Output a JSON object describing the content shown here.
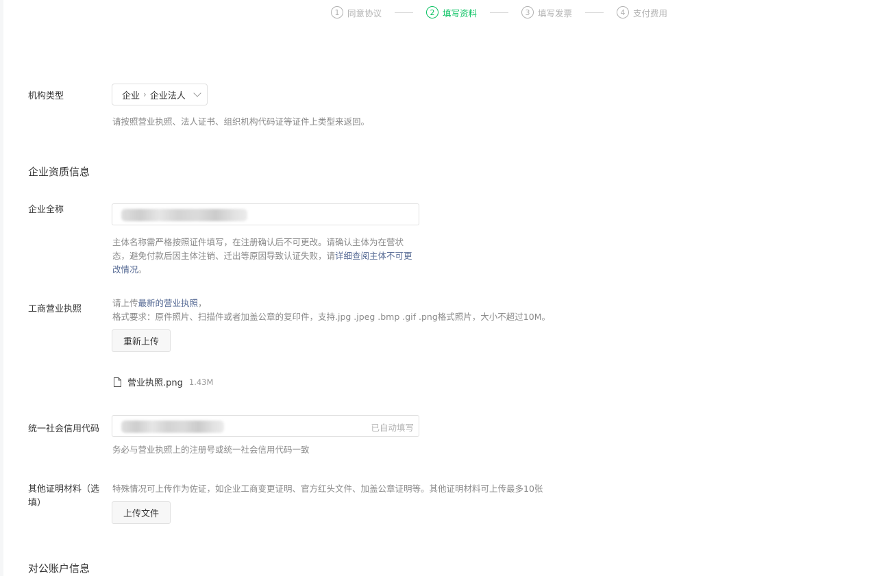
{
  "steps": [
    {
      "num": "1",
      "label": "同意协议"
    },
    {
      "num": "2",
      "label": "填写资料"
    },
    {
      "num": "3",
      "label": "填写发票"
    },
    {
      "num": "4",
      "label": "支付费用"
    }
  ],
  "org_type": {
    "label": "机构类型",
    "selected_primary": "企业",
    "selected_secondary": "企业法人",
    "hint": "请按照营业执照、法人证书、组织机构代码证等证件上类型来返回。"
  },
  "section_qualification": "企业资质信息",
  "company_name": {
    "label": "企业全称",
    "hint_line1": "主体名称需严格按照证件填写，在注册确认后不可更改。请确认主体为在营状",
    "hint_line2_prefix": "态，避免付款后因主体注销、迁出等原因导致认证失败，请",
    "hint_line2_link": "详细查阅主体不可更",
    "hint_line3_link": "改情况",
    "hint_line3_suffix": "。"
  },
  "license": {
    "label": "工商营业执照",
    "hint_prefix": "请上传",
    "hint_link": "最新的营业执照",
    "hint_suffix": "，",
    "format": "格式要求：原件照片、扫描件或者加盖公章的复印件，支持.jpg .jpeg .bmp .gif .png格式照片，大小不超过10M。",
    "reupload_button": "重新上传",
    "file_name": "营业执照.png",
    "file_size": "1.43M"
  },
  "credit_code": {
    "label": "统一社会信用代码",
    "autofill": "已自动填写",
    "hint": "务必与营业执照上的注册号或统一社会信用代码一致"
  },
  "other_material": {
    "label_line1": "其他证明材料（选",
    "label_line2": "填）",
    "hint": "特殊情况可上传作为佐证，如企业工商变更证明、官方红头文件、加盖公章证明等。其他证明材料可上传最多10张",
    "upload_button": "上传文件"
  },
  "section_account": "对公账户信息"
}
